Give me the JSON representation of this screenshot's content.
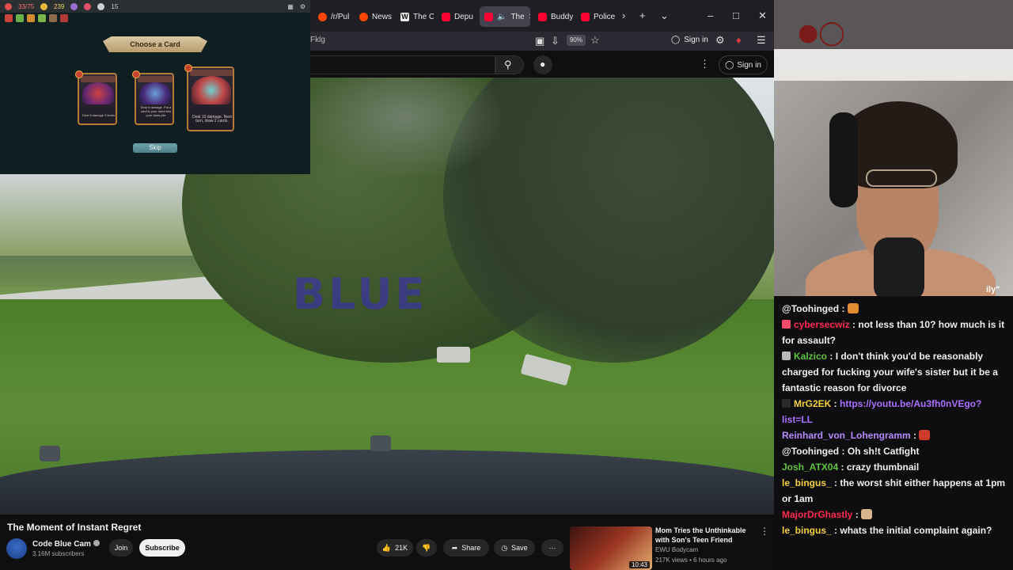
{
  "game": {
    "hud": {
      "hp": "33/75",
      "gold": "239",
      "counter": "15"
    },
    "banner": "Choose a Card",
    "cards": [
      {
        "text": "Deal 9 damage 3 times."
      },
      {
        "text": "Deal 4 damage. Put a card in your hand into your draw pile"
      },
      {
        "text": "Deal 10 damage. Next turn, draw 2 cards."
      }
    ],
    "skip": "Skip"
  },
  "browser": {
    "tabs": [
      {
        "label": "/r/Pul",
        "icon": "reddit-icon"
      },
      {
        "label": "News",
        "icon": "reddit-icon"
      },
      {
        "label": "The C",
        "icon": "wikipedia-icon"
      },
      {
        "label": "Depu",
        "icon": "youtube-icon"
      },
      {
        "label": "The",
        "icon": "youtube-icon",
        "active": true
      },
      {
        "label": "Buddy",
        "icon": "youtube-icon"
      },
      {
        "label": "Police",
        "icon": "youtube-icon"
      }
    ],
    "address_fragment": "Fklg",
    "zoom": "90%",
    "signin": "Sign in",
    "yt_signin": "Sign in"
  },
  "video": {
    "watermark": "BLUE"
  },
  "webcam": {
    "tag": "ily\""
  },
  "chat": [
    {
      "user": "@Toohinged",
      "color": "#efeff1",
      "badge": "",
      "text": "",
      "emote": "#e28b2f"
    },
    {
      "user": "cybersecwiz",
      "color": "#ff2b4f",
      "badge": "#ff4b6a",
      "text": "not less than 10? how much is it for assault?"
    },
    {
      "user": "Kalzico",
      "color": "#5fc43c",
      "badge": "#b8b8b8",
      "text": "I don't think you'd be reasonably charged for fucking your wife's sister but it be a fantastic reason for divorce"
    },
    {
      "user": "MrG2EK",
      "color": "#f4d03f",
      "badge": "#2a2a2a",
      "text": "",
      "link": "https://youtu.be/Au3fh0nVEgo?list=LL"
    },
    {
      "user": "Reinhard_von_Lohengramm",
      "color": "#b58cff",
      "badge": "",
      "text": "",
      "emote": "#d13a28"
    },
    {
      "user": "@Toohinged",
      "color": "#efeff1",
      "badge": "",
      "text": "Oh sh!t Catfight"
    },
    {
      "user": "Josh_ATX04",
      "color": "#5fc43c",
      "badge": "",
      "text": "crazy thumbnail"
    },
    {
      "user": "le_bingus_",
      "color": "#f4d03f",
      "badge": "",
      "text": "the worst shit either happens at 1pm or 1am"
    },
    {
      "user": "MajorDrGhastly",
      "color": "#ff2b4f",
      "badge": "",
      "text": "",
      "emote": "#d8b48c"
    },
    {
      "user": "le_bingus_",
      "color": "#f4d03f",
      "badge": "",
      "text": "whats the initial complaint again?"
    }
  ],
  "info": {
    "title": "The Moment of Instant Regret",
    "channel": "Code Blue Cam",
    "subscribers": "3.16M subscribers",
    "join": "Join",
    "subscribe": "Subscribe",
    "likes": "21K",
    "share": "Share",
    "save": "Save",
    "recommended": {
      "title": "Mom Tries the Unthinkable with Son's Teen Friend",
      "channel": "EWU Bodycam",
      "meta": "217K views • 6 hours ago",
      "duration": "10:43"
    }
  }
}
